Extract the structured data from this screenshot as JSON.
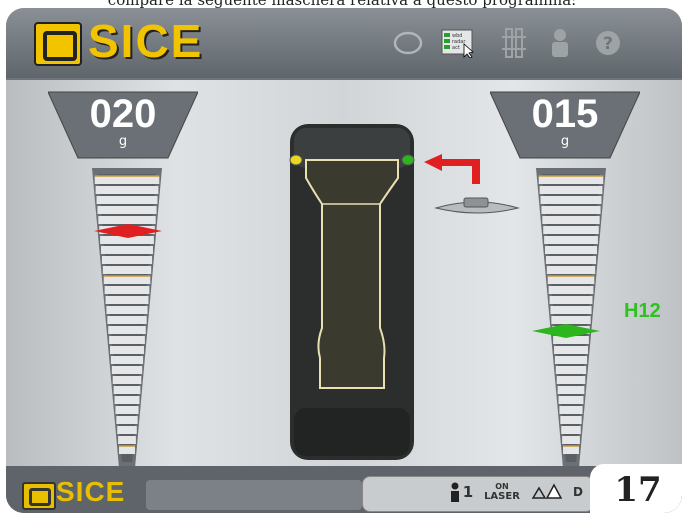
{
  "caption": "compare la seguente maschera relativa a questo programma:",
  "brand": {
    "name": "SICE",
    "color": "#f2c400"
  },
  "toolbar": {
    "icons": [
      "tyre-icon",
      "wheel-data-icon",
      "spoke-icon",
      "operator-icon",
      "help-icon"
    ],
    "data_icon_lines": [
      "wbd",
      "radar",
      "act"
    ]
  },
  "left_plane": {
    "value": "020",
    "unit": "g",
    "marker_color": "#e02020",
    "marker_level": 0.78
  },
  "right_plane": {
    "value": "015",
    "unit": "g",
    "marker_color": "#2cb51d",
    "marker_level": 0.42,
    "position_label": "H12"
  },
  "status_bar": {
    "operator_number": "1",
    "laser_label_top": "ON",
    "laser_label_bottom": "LASER",
    "truncated_label": "D"
  },
  "page_number": "17"
}
